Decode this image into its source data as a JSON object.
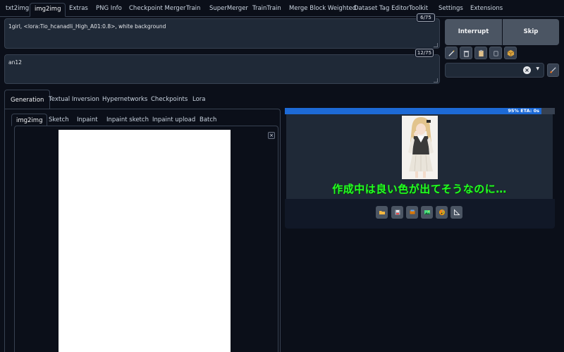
{
  "top_tabs": {
    "items": [
      {
        "label": "txt2img"
      },
      {
        "label": "img2img",
        "active": true
      },
      {
        "label": "Extras"
      },
      {
        "label": "PNG Info"
      },
      {
        "label": "Checkpoint Merger"
      },
      {
        "label": "Train"
      },
      {
        "label": "SuperMerger"
      },
      {
        "label": "TrainTrain"
      },
      {
        "label": "Merge Block Weighted"
      },
      {
        "label": "Dataset Tag Editor"
      },
      {
        "label": "Toolkit"
      },
      {
        "label": "Settings"
      },
      {
        "label": "Extensions"
      }
    ]
  },
  "prompt": {
    "positive": "1girl, <lora:Tio_hcanadli_High_A01:0.8>, white background",
    "positive_count": "6/75",
    "negative": "an12",
    "negative_count": "12/75"
  },
  "actions": {
    "interrupt_label": "Interrupt",
    "skip_label": "Skip"
  },
  "tools": [
    "pencil-icon",
    "trash-icon",
    "clipboard-icon",
    "card-icon",
    "box-icon"
  ],
  "styles": {
    "clear_symbol": "×",
    "caret_symbol": "▼"
  },
  "section_tabs": {
    "items": [
      {
        "label": "Generation",
        "active": true
      },
      {
        "label": "Textual Inversion"
      },
      {
        "label": "Hypernetworks"
      },
      {
        "label": "Checkpoints"
      },
      {
        "label": "Lora"
      }
    ]
  },
  "mode_tabs": {
    "items": [
      {
        "label": "img2img",
        "active": true
      },
      {
        "label": "Sketch"
      },
      {
        "label": "Inpaint"
      },
      {
        "label": "Inpaint sketch"
      },
      {
        "label": "Inpaint upload"
      },
      {
        "label": "Batch"
      }
    ]
  },
  "canvas": {
    "close_symbol": "×"
  },
  "progress": {
    "fraction": 0.95,
    "label": "95% ETA: 0s"
  },
  "output": {
    "caption": "作成中は良い色が出てそうなのに…"
  },
  "output_buttons": [
    "folder-icon",
    "save-icon",
    "zip-icon",
    "image-icon",
    "palette-icon",
    "ruler-icon"
  ],
  "colors": {
    "background": "#0b0f19",
    "panel": "#1f2937",
    "border": "#374151",
    "progress": "#1d6ad6",
    "caption": "#22ff22",
    "button": "#4b5563"
  }
}
